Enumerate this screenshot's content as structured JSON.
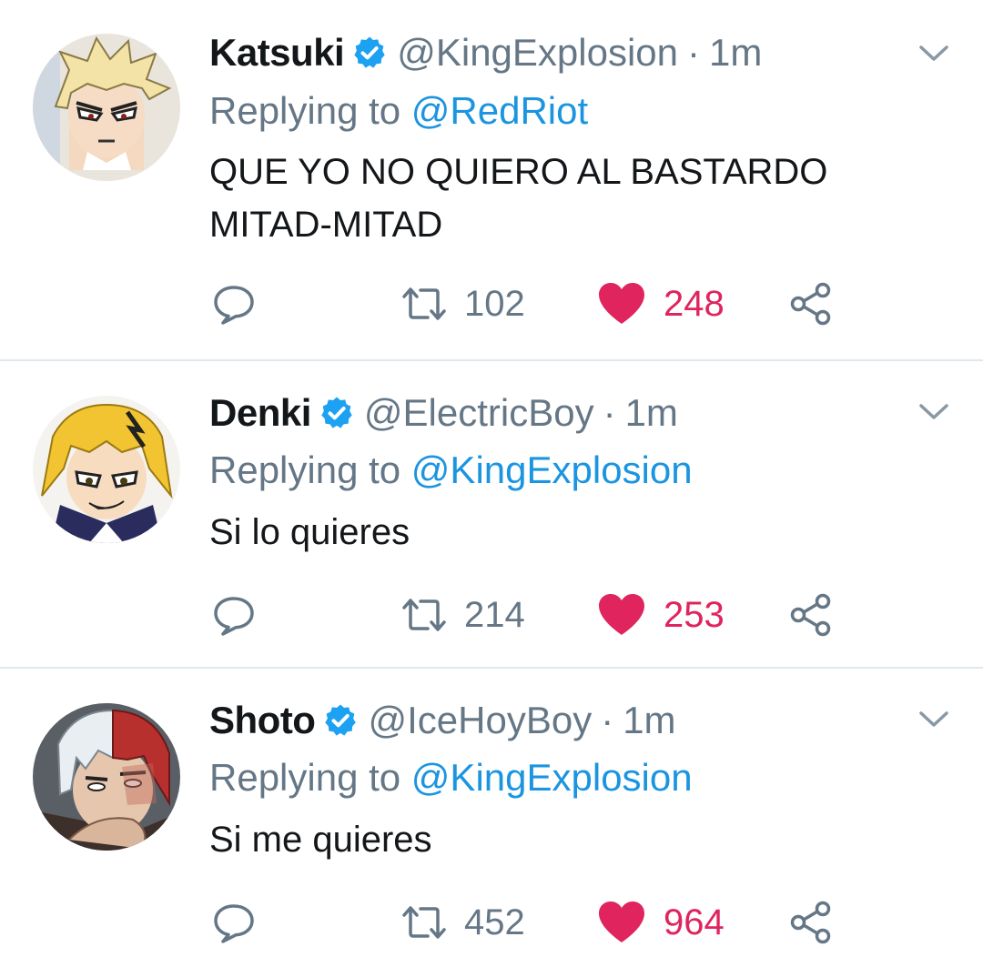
{
  "tweets": [
    {
      "name": "Katsuki",
      "handle": "@KingExplosion",
      "dot": "·",
      "time": "1m",
      "replying_prefix": "Replying to ",
      "replying_to": "@RedRiot",
      "text": "QUE YO NO QUIERO AL BASTARDO MITAD-MITAD",
      "retweets": "102",
      "likes": "248",
      "avatar_icon": "blond-spiky-hair-avatar"
    },
    {
      "name": "Denki",
      "handle": "@ElectricBoy",
      "dot": "·",
      "time": "1m",
      "replying_prefix": "Replying to ",
      "replying_to": "@KingExplosion",
      "text": "Si lo quieres",
      "retweets": "214",
      "likes": "253",
      "avatar_icon": "yellow-hair-avatar"
    },
    {
      "name": "Shoto",
      "handle": "@IceHoyBoy",
      "dot": "·",
      "time": "1m",
      "replying_prefix": "Replying to ",
      "replying_to": "@KingExplosion",
      "text": "Si me quieres",
      "retweets": "452",
      "likes": "964",
      "avatar_icon": "white-red-hair-avatar"
    }
  ],
  "colors": {
    "text_primary": "#14171a",
    "text_secondary": "#657786",
    "mention": "#1b95e0",
    "verified": "#1da1f2",
    "like": "#e0245e",
    "divider": "#e1e8ed"
  },
  "icons": [
    "verified-badge-icon",
    "caret-down-icon",
    "reply-icon",
    "retweet-icon",
    "heart-icon",
    "share-icon"
  ]
}
